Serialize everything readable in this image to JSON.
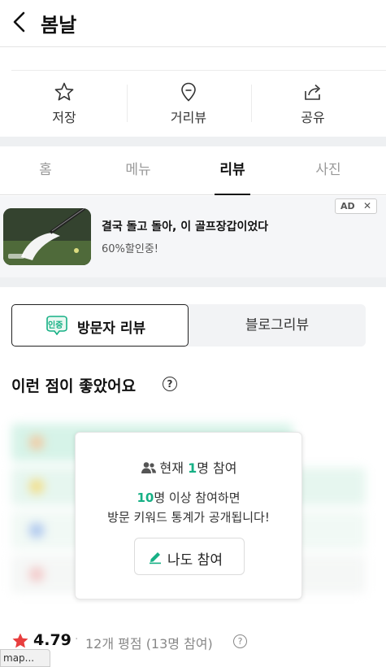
{
  "header": {
    "title": "봄날"
  },
  "actions": [
    {
      "label": "저장",
      "icon": "star-icon"
    },
    {
      "label": "거리뷰",
      "icon": "location-pin-icon"
    },
    {
      "label": "공유",
      "icon": "share-icon"
    }
  ],
  "tabs": [
    {
      "label": "홈",
      "active": false
    },
    {
      "label": "메뉴",
      "active": false
    },
    {
      "label": "리뷰",
      "active": true
    },
    {
      "label": "사진",
      "active": false
    }
  ],
  "ad": {
    "title": "결국 돌고 돌아, 이 골프장갑이었다",
    "subtitle": "60%할인중!",
    "badge": "AD",
    "close": "✕"
  },
  "review_segment": {
    "visitor_label": "방문자 리뷰",
    "visitor_badge": "인증",
    "blog_label": "블로그리뷰",
    "active": "visitor"
  },
  "keywords": {
    "title": "이런 점이 좋았어요",
    "help": "?",
    "overlay": {
      "count_prefix": "현재 ",
      "count_num": "1",
      "count_suffix": "명 참여",
      "line1_num": "10",
      "line1_text": "명 이상 참여하면",
      "line2_text": "방문 키워드 통계가 공개됩니다!",
      "button_label": "나도 참여"
    }
  },
  "rating": {
    "score": "4.79",
    "separator": "·",
    "text": "12개 평점 (13명 참여)",
    "help": "?"
  },
  "status_tip": {
    "text": "map..."
  },
  "colors": {
    "accent_green": "#16b085",
    "star_red": "#e83e3e"
  }
}
